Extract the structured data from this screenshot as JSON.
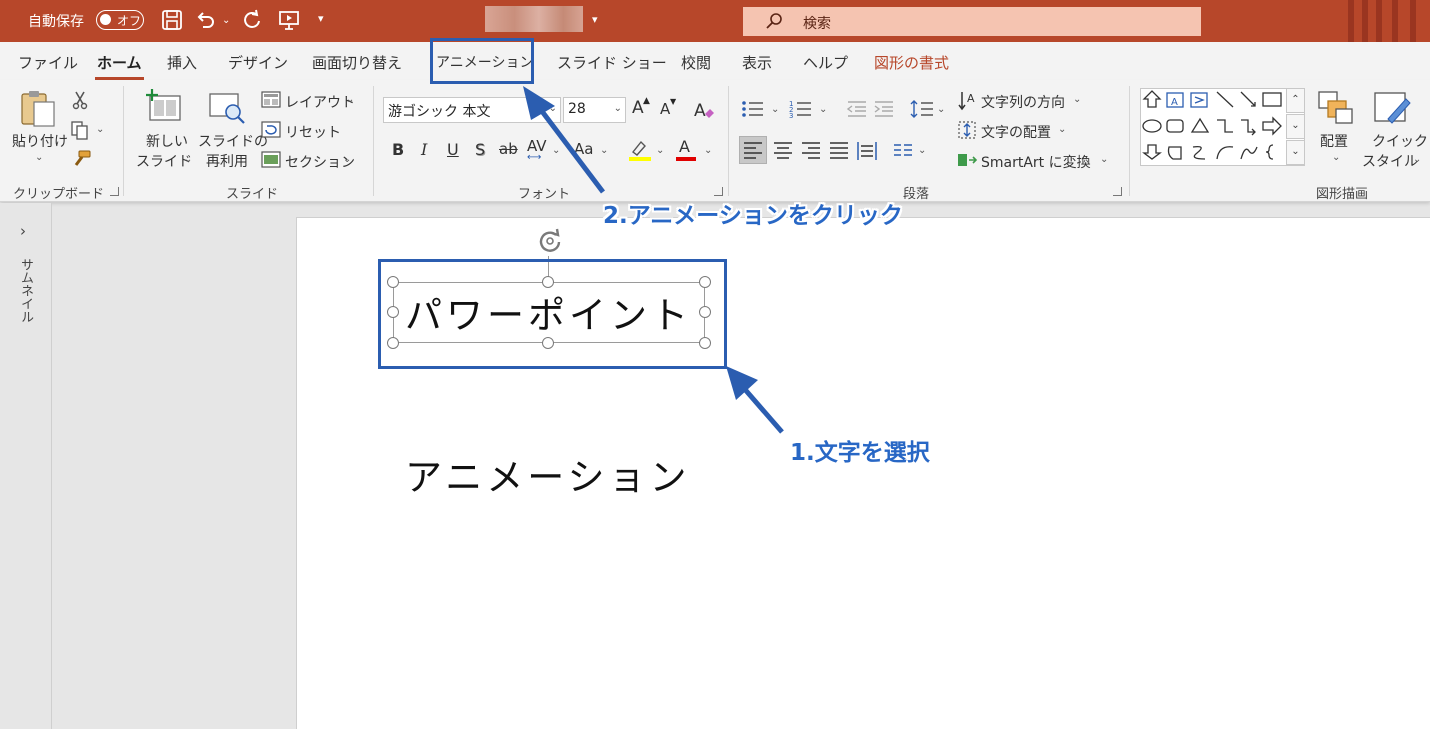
{
  "titlebar": {
    "autosave_label": "自動保存",
    "autosave_state": "オフ",
    "search_placeholder": "検索"
  },
  "tabs": [
    {
      "label": "ファイル"
    },
    {
      "label": "ホーム"
    },
    {
      "label": "挿入"
    },
    {
      "label": "デザイン"
    },
    {
      "label": "画面切り替え"
    },
    {
      "label": "アニメーション"
    },
    {
      "label": "スライド ショー"
    },
    {
      "label": "校閲"
    },
    {
      "label": "表示"
    },
    {
      "label": "ヘルプ"
    },
    {
      "label": "図形の書式"
    }
  ],
  "clipboard": {
    "paste_line1": "貼り付け",
    "group_label": "クリップボード"
  },
  "slides_group": {
    "new_slide_line1": "新しい",
    "new_slide_line2": "スライド",
    "reuse_line1": "スライドの",
    "reuse_line2": "再利用",
    "layout": "レイアウト",
    "reset": "リセット",
    "section": "セクション",
    "group_label": "スライド"
  },
  "font_group": {
    "font_name": "游ゴシック 本文",
    "font_size": "28",
    "bold": "B",
    "italic": "I",
    "underline": "U",
    "shadow": "S",
    "strike": "ab",
    "spacing": "AV",
    "case": "Aa",
    "grow": "A",
    "shrink": "A",
    "font_color": "A",
    "group_label": "フォント"
  },
  "paragraph_group": {
    "text_direction": "文字列の方向",
    "align_text": "文字の配置",
    "smartart": "SmartArt に変換",
    "group_label": "段落"
  },
  "drawing_group": {
    "arrange": "配置",
    "quick_style_line1": "クイック",
    "quick_style_line2": "スタイル",
    "group_label": "図形描画"
  },
  "thumbnail_pane": {
    "label": "サムネイル",
    "expand": "›"
  },
  "slide": {
    "textbox1": "パワーポイント",
    "textbox2": "アニメーション"
  },
  "annotations": {
    "step1": "1.文字を選択",
    "step2": "2.アニメーションをクリック"
  },
  "colors": {
    "titlebar": "#b7472a",
    "annotation": "#2b5db0",
    "highlight_yellow": "#ffff00",
    "font_red": "#e00000"
  }
}
